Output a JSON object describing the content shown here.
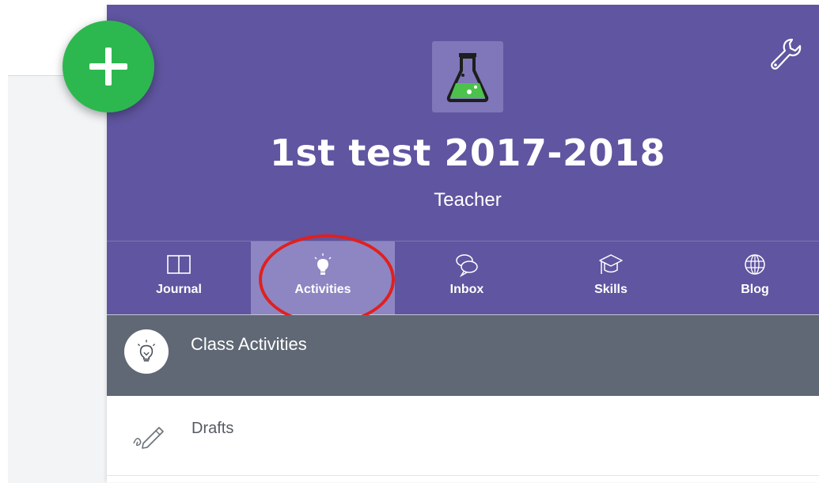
{
  "class": {
    "title": "1st test 2017-2018",
    "role": "Teacher",
    "icon": "flask-icon"
  },
  "header": {
    "settings_icon": "wrench-icon",
    "add_icon": "plus-icon"
  },
  "tabs": [
    {
      "label": "Journal",
      "icon": "book-icon",
      "active": false
    },
    {
      "label": "Activities",
      "icon": "lightbulb-icon",
      "active": true
    },
    {
      "label": "Inbox",
      "icon": "chat-bubbles-icon",
      "active": false
    },
    {
      "label": "Skills",
      "icon": "graduation-cap-icon",
      "active": false
    },
    {
      "label": "Blog",
      "icon": "globe-icon",
      "active": false
    }
  ],
  "section": {
    "title": "Class Activities",
    "icon": "lightbulb-icon"
  },
  "list": [
    {
      "label": "Drafts",
      "icon": "pencil-icon"
    }
  ],
  "colors": {
    "header_purple": "#5f55a0",
    "active_tab": "#8d86c3",
    "section_bar": "#5f6874",
    "fab_green": "#2db84f",
    "annotation_red": "#e02020"
  }
}
